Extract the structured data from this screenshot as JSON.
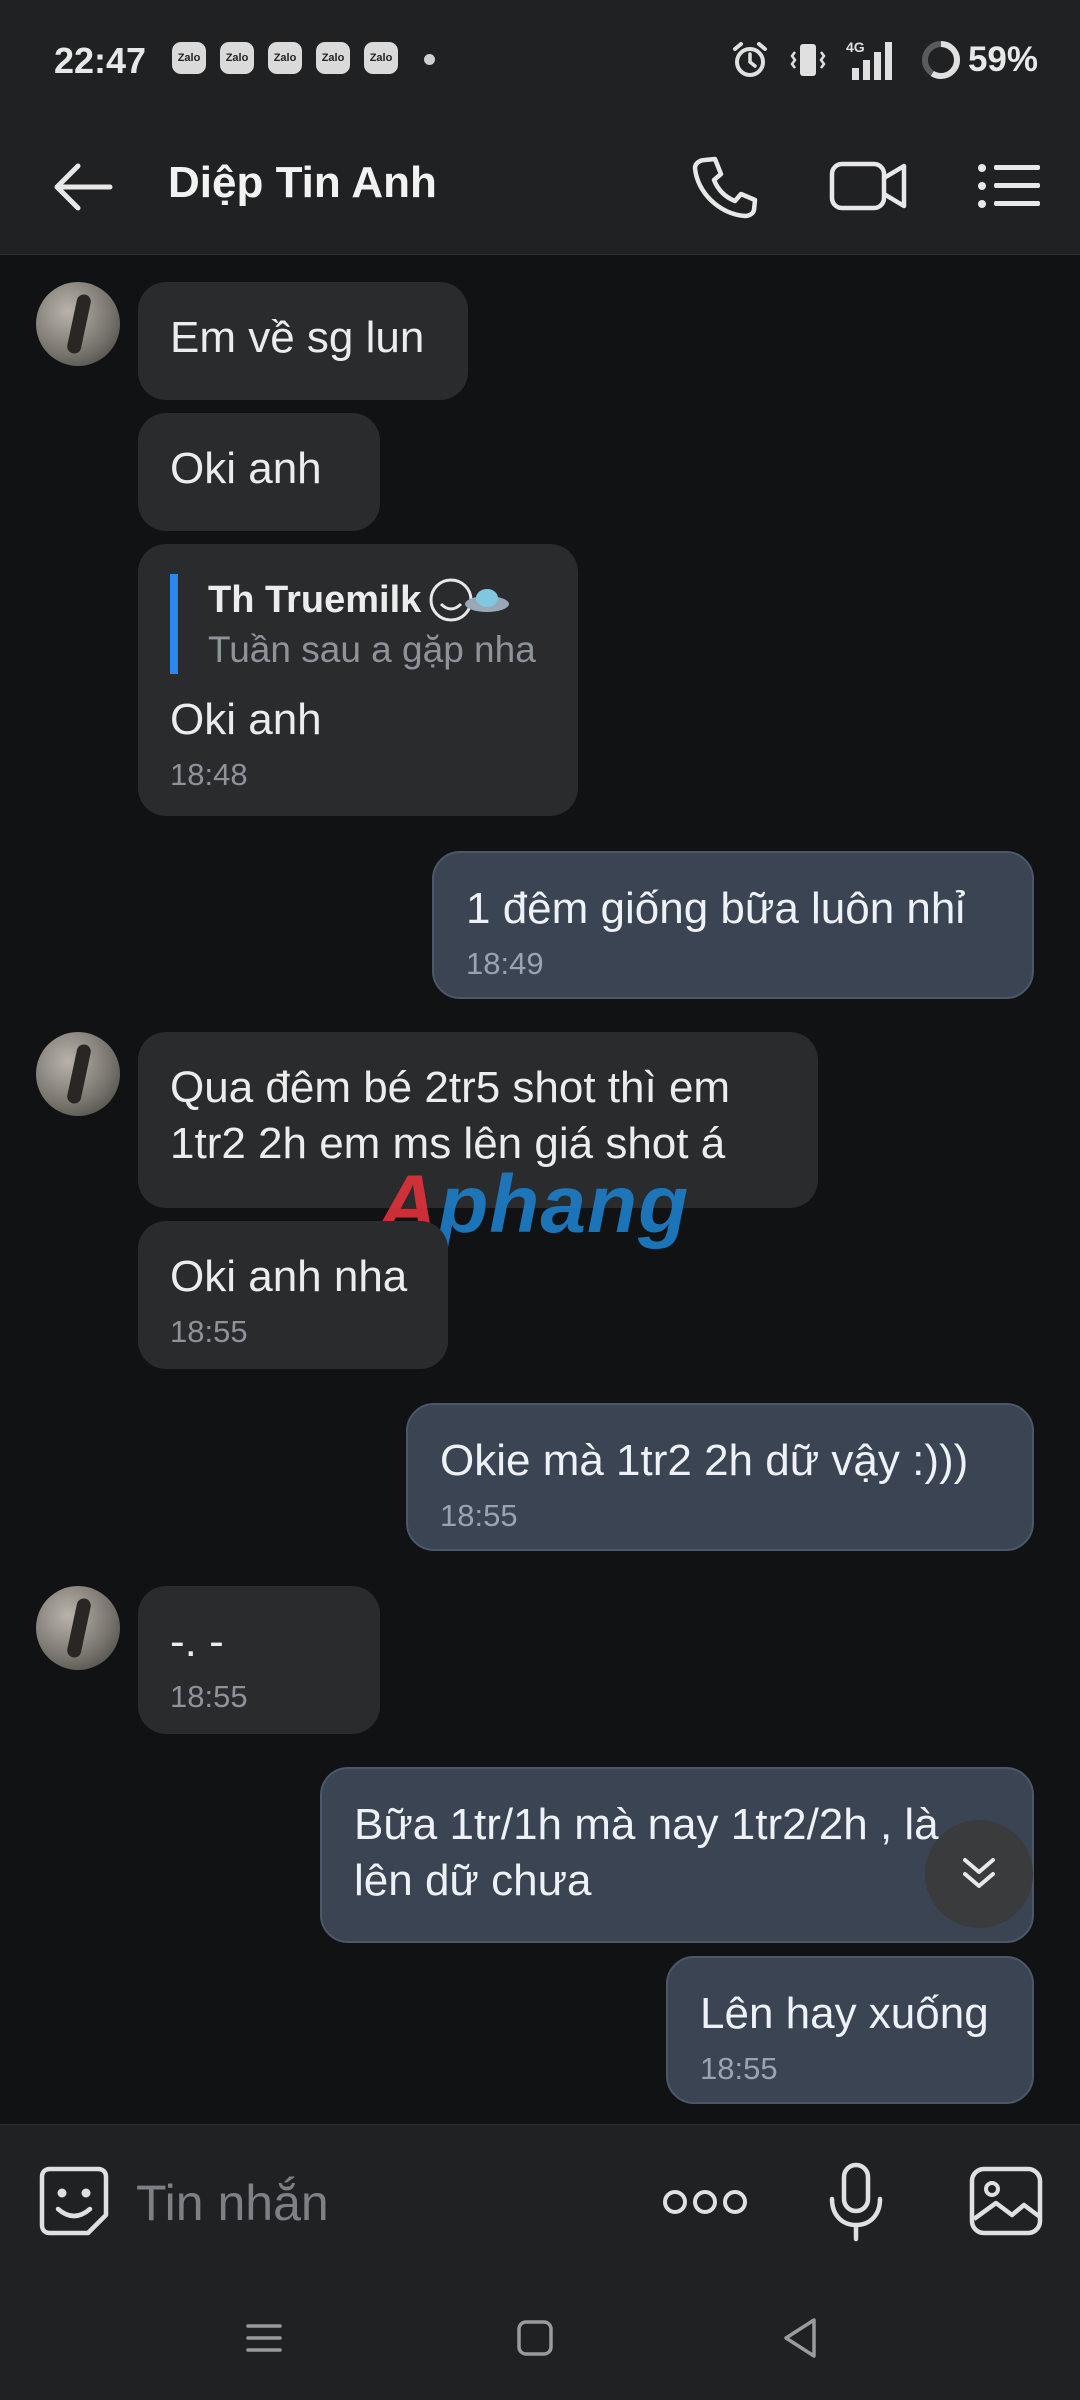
{
  "status_bar": {
    "time": "22:47",
    "notification_icons": [
      "Zalo",
      "Zalo",
      "Zalo",
      "Zalo",
      "Zalo"
    ],
    "network": "4G",
    "battery": "59%",
    "icons": [
      "alarm-icon",
      "vibrate-icon",
      "signal-icon",
      "battery-icon"
    ]
  },
  "header": {
    "contact_name": "Diệp Tin Anh",
    "icons": [
      "back-arrow-icon",
      "phone-icon",
      "video-camera-icon",
      "list-menu-icon"
    ]
  },
  "messages": [
    {
      "direction": "in",
      "text": "Em về sg lun"
    },
    {
      "direction": "in",
      "text": "Oki anh"
    },
    {
      "direction": "in",
      "quote": {
        "sender": "Th Truemilk",
        "text": "Tuần sau a gặp nha"
      },
      "text": "Oki anh",
      "time": "18:48"
    },
    {
      "direction": "out",
      "text": "1 đêm giống bữa luôn nhỉ",
      "time": "18:49"
    },
    {
      "direction": "in",
      "text": "Qua đêm bé 2tr5 shot thì em 1tr2 2h em ms lên giá shot á"
    },
    {
      "direction": "in",
      "text": "Oki anh nha",
      "time": "18:55"
    },
    {
      "direction": "out",
      "text": "Okie mà 1tr2 2h dữ vậy :)))",
      "time": "18:55"
    },
    {
      "direction": "in",
      "text": "-. -",
      "time": "18:55"
    },
    {
      "direction": "out",
      "text": "Bữa 1tr/1h mà nay 1tr2/2h , là lên dữ chưa"
    },
    {
      "direction": "out",
      "text": "Lên hay xuống",
      "time": "18:55"
    }
  ],
  "watermark": {
    "first": "A",
    "rest": "phang"
  },
  "input_bar": {
    "placeholder": "Tin nhắn",
    "icons": [
      "emoji-sticker-icon",
      "more-dots-icon",
      "microphone-icon",
      "image-icon"
    ]
  },
  "nav_bar": {
    "icons": [
      "recents-icon",
      "home-icon",
      "back-icon"
    ]
  },
  "colors": {
    "background": "#111213",
    "bar": "#202122",
    "incoming_bubble": "#2a2b2d",
    "outgoing_bubble": "#3a4452",
    "quote_accent": "#2a86f0"
  }
}
